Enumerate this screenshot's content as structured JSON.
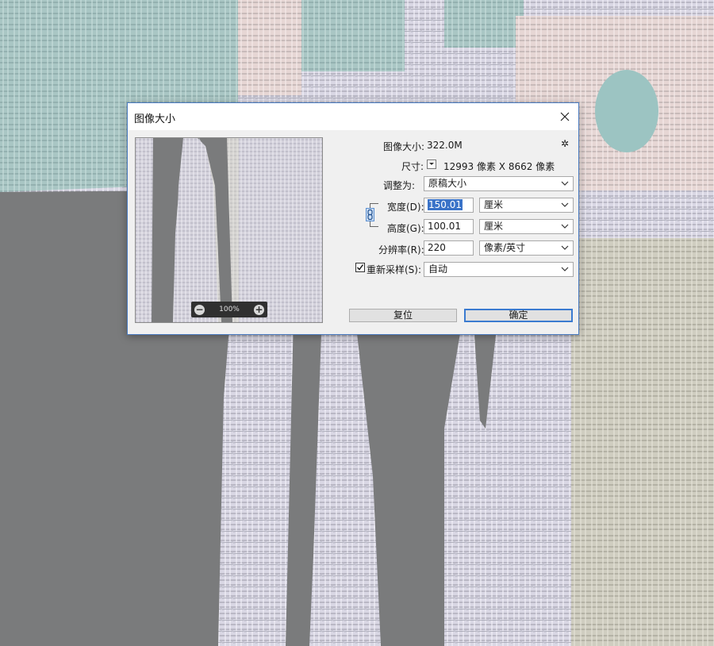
{
  "dialog": {
    "title": "图像大小",
    "image_size_label": "图像大小:",
    "image_size_value": "322.0M",
    "dimensions_label": "尺寸:",
    "dimensions_value": "12993 像素  X  8662 像素",
    "fit_to_label": "调整为:",
    "fit_to_value": "原稿大小",
    "width_label": "宽度(D):",
    "width_value": "150.01",
    "width_unit": "厘米",
    "height_label": "高度(G):",
    "height_value": "100.01",
    "height_unit": "厘米",
    "resolution_label": "分辨率(R):",
    "resolution_value": "220",
    "resolution_unit": "像素/英寸",
    "resample_label": "重新采样(S):",
    "resample_checked": true,
    "resample_value": "自动",
    "reset_label": "复位",
    "ok_label": "确定"
  },
  "preview": {
    "zoom_label": "100%",
    "zoom_out_icon": "minus-circle-icon",
    "zoom_in_icon": "plus-circle-icon"
  },
  "icons": {
    "close": "close-icon",
    "settings": "gear-icon",
    "constrain": "chain-link-icon",
    "dropdown": "chevron-down-icon",
    "checkbox": "checkmark-icon"
  },
  "colors": {
    "canvas_gray": "#7a7b7c",
    "dialog_bg": "#f0f0f0",
    "accent_blue": "#3b7bd0",
    "selection_blue": "#3a73c8"
  }
}
